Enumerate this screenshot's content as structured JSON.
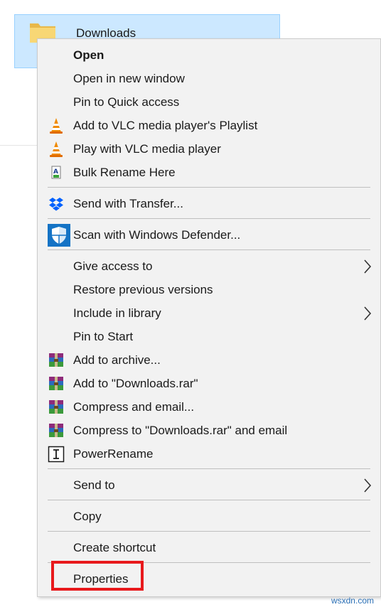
{
  "explorer": {
    "folder_label": "Downloads"
  },
  "menu": {
    "items": [
      {
        "label": "Open",
        "bold": true,
        "icon": "",
        "arrow": false
      },
      {
        "label": "Open in new window",
        "icon": "",
        "arrow": false
      },
      {
        "label": "Pin to Quick access",
        "icon": "",
        "arrow": false
      },
      {
        "label": "Add to VLC media player's Playlist",
        "icon": "vlc-icon",
        "arrow": false
      },
      {
        "label": "Play with VLC media player",
        "icon": "vlc-icon",
        "arrow": false
      },
      {
        "label": "Bulk Rename Here",
        "icon": "bulk-rename-icon",
        "arrow": false
      },
      {
        "label": "Send with Transfer...",
        "icon": "dropbox-icon",
        "arrow": false
      },
      {
        "label": "Scan with Windows Defender...",
        "icon": "defender-shield-icon",
        "arrow": false
      },
      {
        "label": "Give access to",
        "icon": "",
        "arrow": true
      },
      {
        "label": "Restore previous versions",
        "icon": "",
        "arrow": false
      },
      {
        "label": "Include in library",
        "icon": "",
        "arrow": true
      },
      {
        "label": "Pin to Start",
        "icon": "",
        "arrow": false
      },
      {
        "label": "Add to archive...",
        "icon": "winrar-icon",
        "arrow": false
      },
      {
        "label": "Add to \"Downloads.rar\"",
        "icon": "winrar-icon",
        "arrow": false
      },
      {
        "label": "Compress and email...",
        "icon": "winrar-icon",
        "arrow": false
      },
      {
        "label": "Compress to \"Downloads.rar\" and email",
        "icon": "winrar-icon",
        "arrow": false
      },
      {
        "label": "PowerRename",
        "icon": "powerrename-icon",
        "arrow": false
      },
      {
        "label": "Send to",
        "icon": "",
        "arrow": true
      },
      {
        "label": "Copy",
        "icon": "",
        "arrow": false
      },
      {
        "label": "Create shortcut",
        "icon": "",
        "arrow": false
      },
      {
        "label": "Properties",
        "icon": "",
        "arrow": false
      }
    ]
  },
  "watermark": "wsxdn.com",
  "colors": {
    "menu_bg": "#f2f2f2",
    "selection_bg": "#cce8ff",
    "highlight_red": "#e8191c",
    "separator": "#bfbfbf"
  }
}
